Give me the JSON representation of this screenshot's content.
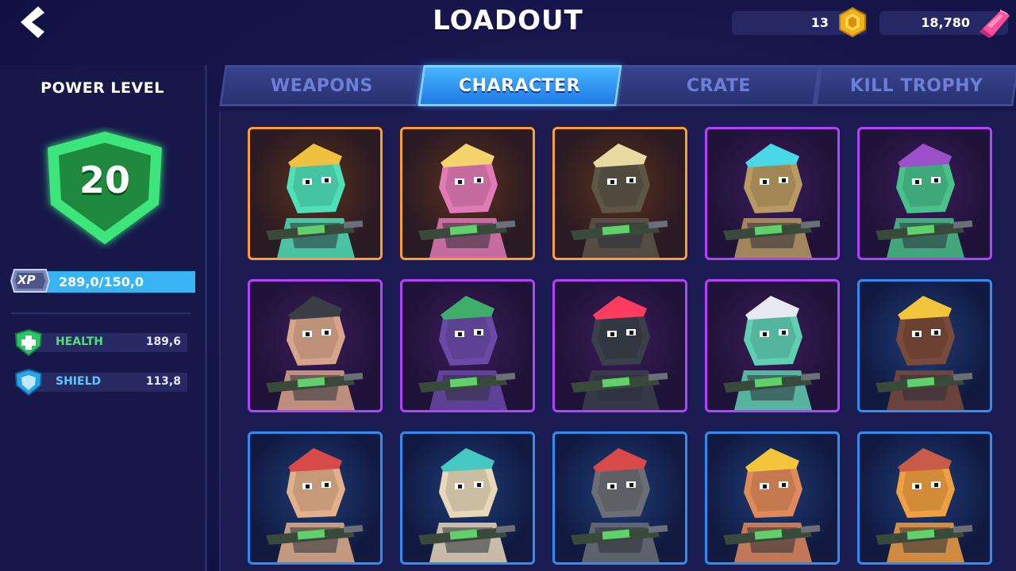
{
  "header": {
    "title": "LOADOUT",
    "coins": "13",
    "gems": "18,780"
  },
  "left_panel": {
    "power_label": "POWER LEVEL",
    "power_level": "20",
    "xp_label": "XP",
    "xp_text": "289,0/150,0",
    "stats": [
      {
        "label": "HEALTH",
        "value": "189,6",
        "icon": "health-cross-icon"
      },
      {
        "label": "SHIELD",
        "value": "113,8",
        "icon": "shield-icon"
      }
    ]
  },
  "tabs": [
    {
      "label": "WEAPONS",
      "active": false
    },
    {
      "label": "CHARACTER",
      "active": true
    },
    {
      "label": "CRATE",
      "active": false
    },
    {
      "label": "KILL TROPHY",
      "active": false
    }
  ],
  "characters": [
    {
      "rarity": "legendary",
      "icon": "flaming-skull-king-icon",
      "skin": "#4fe0b8",
      "accent": "#f0c040"
    },
    {
      "rarity": "legendary",
      "icon": "pink-bunny-icon",
      "skin": "#e27ab6",
      "accent": "#f3d36b"
    },
    {
      "rarity": "legendary",
      "icon": "antlered-beast-icon",
      "skin": "#5c5548",
      "accent": "#e8d9a0"
    },
    {
      "rarity": "epic",
      "icon": "steampunk-goggles-icon",
      "skin": "#b89a62",
      "accent": "#4ad8e6"
    },
    {
      "rarity": "epic",
      "icon": "dino-croc-icon",
      "skin": "#49c18a",
      "accent": "#9b4fc9"
    },
    {
      "rarity": "epic",
      "icon": "military-officer-icon",
      "skin": "#d9a58a",
      "accent": "#3a3d44"
    },
    {
      "rarity": "epic",
      "icon": "pirate-octopus-icon",
      "skin": "#6a4aa8",
      "accent": "#3fae6a"
    },
    {
      "rarity": "epic",
      "icon": "cyborg-ninja-icon",
      "skin": "#3b3f4a",
      "accent": "#ff3b5f"
    },
    {
      "rarity": "epic",
      "icon": "fish-man-icon",
      "skin": "#5fd0b2",
      "accent": "#e8e8f0"
    },
    {
      "rarity": "rare",
      "icon": "tribal-warrior-icon",
      "skin": "#7a4a3a",
      "accent": "#f3c53a"
    },
    {
      "rarity": "rare",
      "icon": "redcap-grenadier-icon",
      "skin": "#e2b08a",
      "accent": "#d84a4a"
    },
    {
      "rarity": "rare",
      "icon": "cat-gunner-icon",
      "skin": "#e8d8b8",
      "accent": "#45c7c2"
    },
    {
      "rarity": "rare",
      "icon": "gray-wolf-icon",
      "skin": "#6b6e74",
      "accent": "#d84a4a"
    },
    {
      "rarity": "rare",
      "icon": "viking-helmet-icon",
      "skin": "#e08a5a",
      "accent": "#f3c53a"
    },
    {
      "rarity": "rare",
      "icon": "masked-wrestler-icon",
      "skin": "#f0a040",
      "accent": "#c85a4a"
    }
  ],
  "colors": {
    "legendary": "#ff9d2e",
    "epic": "#b341ff",
    "rare": "#2f8ef0",
    "tab_active": "#2f95f5",
    "power_badge": "#2ecc5f"
  }
}
